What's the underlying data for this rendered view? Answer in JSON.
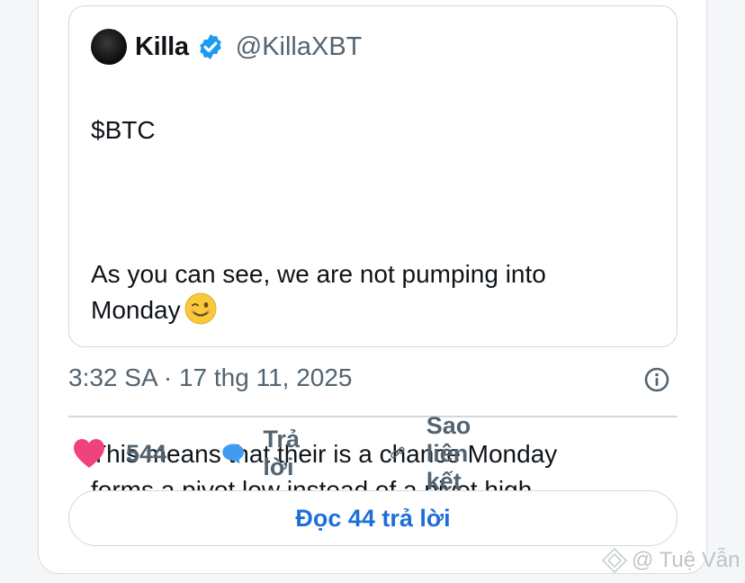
{
  "quoted_tweet": {
    "author_name": "Killa",
    "handle": "@KillaXBT",
    "verified_icon": "verified-badge-icon",
    "text_line1": "$BTC",
    "text_para2": "As you can see, we are not pumping into\nMonday",
    "emoji": "winking-face",
    "text_para3": "This means that their is a chance Monday\nforms a pivot low instead of a pivot high."
  },
  "meta": {
    "timestamp": "3:32 SA · 17 thg 11, 2025"
  },
  "actions": {
    "like_count": "544",
    "reply_label": "Trả lời",
    "copy_link_label": "Sao liên kết"
  },
  "read_replies_label": "Đọc 44 trả lời",
  "watermark": "@ Tuệ Vẫn",
  "colors": {
    "heart": "#f0437c",
    "reply_bubble": "#3f9cf0",
    "link_blue": "#1d6fd6",
    "verified": "#1d9bf0"
  }
}
